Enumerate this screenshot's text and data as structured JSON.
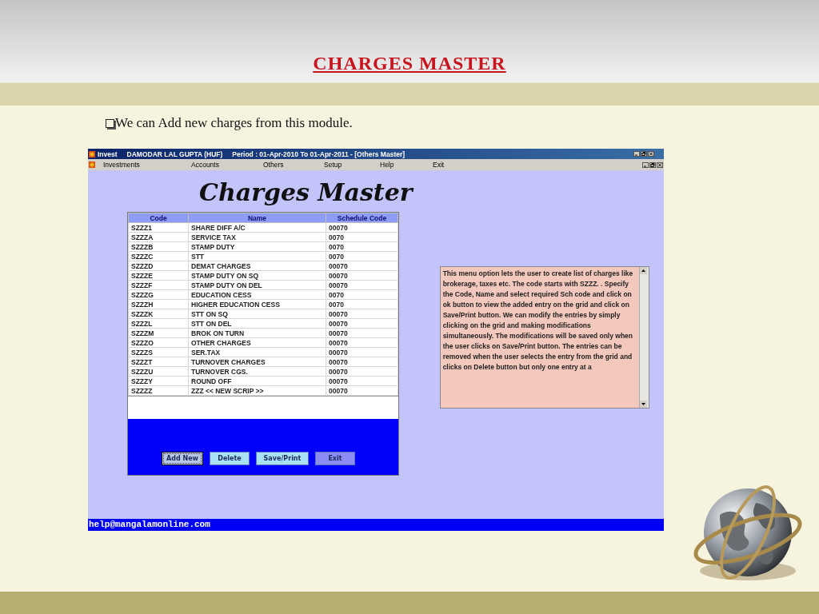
{
  "slide": {
    "title": "CHARGES MASTER",
    "bullet": "We can Add new charges from this module."
  },
  "app": {
    "title_bar": {
      "app_name": "Invest",
      "client": "DAMODAR LAL GUPTA (HUF)",
      "period": "Period : 01-Apr-2010  To  01-Apr-2011 - [Others Master]"
    },
    "menu": [
      "Investments",
      "Accounts",
      "Others",
      "Setup",
      "Help",
      "Exit"
    ],
    "form_title": "Charges Master",
    "grid": {
      "columns": [
        "Code",
        "Name",
        "Schedule Code"
      ],
      "rows": [
        [
          "SZZZ1",
          "SHARE DIFF A/C",
          "00070"
        ],
        [
          "SZZZA",
          "SERVICE TAX",
          "0070"
        ],
        [
          "SZZZB",
          "STAMP DUTY",
          "0070"
        ],
        [
          "SZZZC",
          "STT",
          "0070"
        ],
        [
          "SZZZD",
          "DEMAT CHARGES",
          "00070"
        ],
        [
          "SZZZE",
          "STAMP DUTY ON SQ",
          "00070"
        ],
        [
          "SZZZF",
          "STAMP DUTY ON DEL",
          "00070"
        ],
        [
          "SZZZG",
          "EDUCATION CESS",
          "0070"
        ],
        [
          "SZZZH",
          "HIGHER EDUCATION CESS",
          "0070"
        ],
        [
          "SZZZK",
          "STT ON SQ",
          "00070"
        ],
        [
          "SZZZL",
          "STT ON DEL",
          "00070"
        ],
        [
          "SZZZM",
          "BROK ON TURN",
          "00070"
        ],
        [
          "SZZZO",
          "OTHER CHARGES",
          "00070"
        ],
        [
          "SZZZS",
          "SER.TAX",
          "00070"
        ],
        [
          "SZZZT",
          "TURNOVER CHARGES",
          "00070"
        ],
        [
          "SZZZU",
          "TURNOVER CGS.",
          "00070"
        ],
        [
          "SZZZY",
          "ROUND OFF",
          "00070"
        ],
        [
          "SZZZZ",
          "ZZZ << NEW SCRIP >>",
          "00070"
        ]
      ]
    },
    "help_text": "This menu option lets the user to create list of charges like brokerage, taxes etc. The code starts with SZZZ. . Specify the Code, Name and select required Sch code and click on ok button to view the added entry on the grid and click on Save/Print button. We can modify the entries by simply clicking on the grid and making modifications simultaneously. The modifications will be saved only when the user clicks on Save/Print button. The entries can be removed when the user selects the entry from the grid and clicks on Delete button but only one entry at a",
    "buttons": [
      {
        "label": "Add New",
        "focused": true,
        "color": "#b8c8e8"
      },
      {
        "label": "Delete",
        "focused": false,
        "color": "#a8e0f8"
      },
      {
        "label": "Save/Print",
        "focused": false,
        "color": "#a8e0f8"
      },
      {
        "label": "Exit",
        "focused": false,
        "color": "#8c8cf8"
      }
    ],
    "status_text": "help@mangalamonline.com"
  }
}
